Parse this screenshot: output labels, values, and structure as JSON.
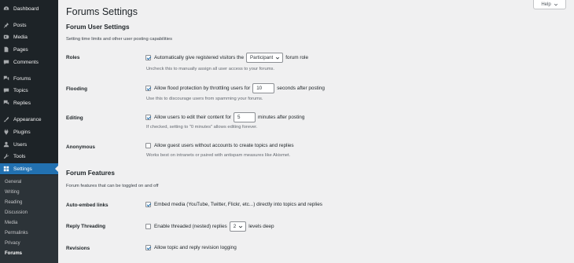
{
  "sidebar": {
    "items": [
      {
        "label": "Dashboard",
        "icon": "dashboard-icon"
      },
      {
        "label": "Posts",
        "icon": "pin-icon"
      },
      {
        "label": "Media",
        "icon": "media-icon"
      },
      {
        "label": "Pages",
        "icon": "page-icon"
      },
      {
        "label": "Comments",
        "icon": "comment-icon"
      },
      {
        "label": "Forums",
        "icon": "forums-icon"
      },
      {
        "label": "Topics",
        "icon": "topics-icon"
      },
      {
        "label": "Replies",
        "icon": "replies-icon"
      },
      {
        "label": "Appearance",
        "icon": "brush-icon"
      },
      {
        "label": "Plugins",
        "icon": "plug-icon"
      },
      {
        "label": "Users",
        "icon": "user-icon"
      },
      {
        "label": "Tools",
        "icon": "wrench-icon"
      },
      {
        "label": "Settings",
        "icon": "settings-icon"
      }
    ],
    "submenu": [
      "General",
      "Writing",
      "Reading",
      "Discussion",
      "Media",
      "Permalinks",
      "Privacy",
      "Forums"
    ]
  },
  "header": {
    "title": "Forums Settings",
    "help_label": "Help"
  },
  "user_section": {
    "title": "Forum User Settings",
    "description": "Setting time limits and other user posting capabilities",
    "roles": {
      "label": "Roles",
      "text_before": "Automatically give registered visitors the",
      "select_value": "Participant",
      "text_after": "forum role",
      "description": "Uncheck this to manually assign all user access to your forums."
    },
    "flooding": {
      "label": "Flooding",
      "text_before": "Allow flood protection by throttling users for",
      "value": "10",
      "text_after": "seconds after posting",
      "description": "Use this to discourage users from spamming your forums."
    },
    "editing": {
      "label": "Editing",
      "text_before": "Allow users to edit their content for",
      "value": "5",
      "text_after": "minutes after posting",
      "description": "If checked, setting to \"0 minutes\" allows editing forever."
    },
    "anonymous": {
      "label": "Anonymous",
      "text": "Allow guest users without accounts to create topics and replies",
      "description": "Works best on intranets or paired with antispam measures like Akismet."
    }
  },
  "features_section": {
    "title": "Forum Features",
    "description": "Forum features that can be toggled on and off",
    "auto_embed": {
      "label": "Auto-embed links",
      "text": "Embed media (YouTube, Twitter, Flickr, etc...) directly into topics and replies"
    },
    "reply_threading": {
      "label": "Reply Threading",
      "text_before": "Enable threaded (nested) replies",
      "select_value": "2",
      "text_after": "levels deep"
    },
    "revisions": {
      "label": "Revisions",
      "text": "Allow topic and reply revision logging"
    }
  },
  "colors": {
    "sidebar_bg": "#1d2327",
    "accent": "#2271b1",
    "page_bg": "#f0f0f1"
  }
}
